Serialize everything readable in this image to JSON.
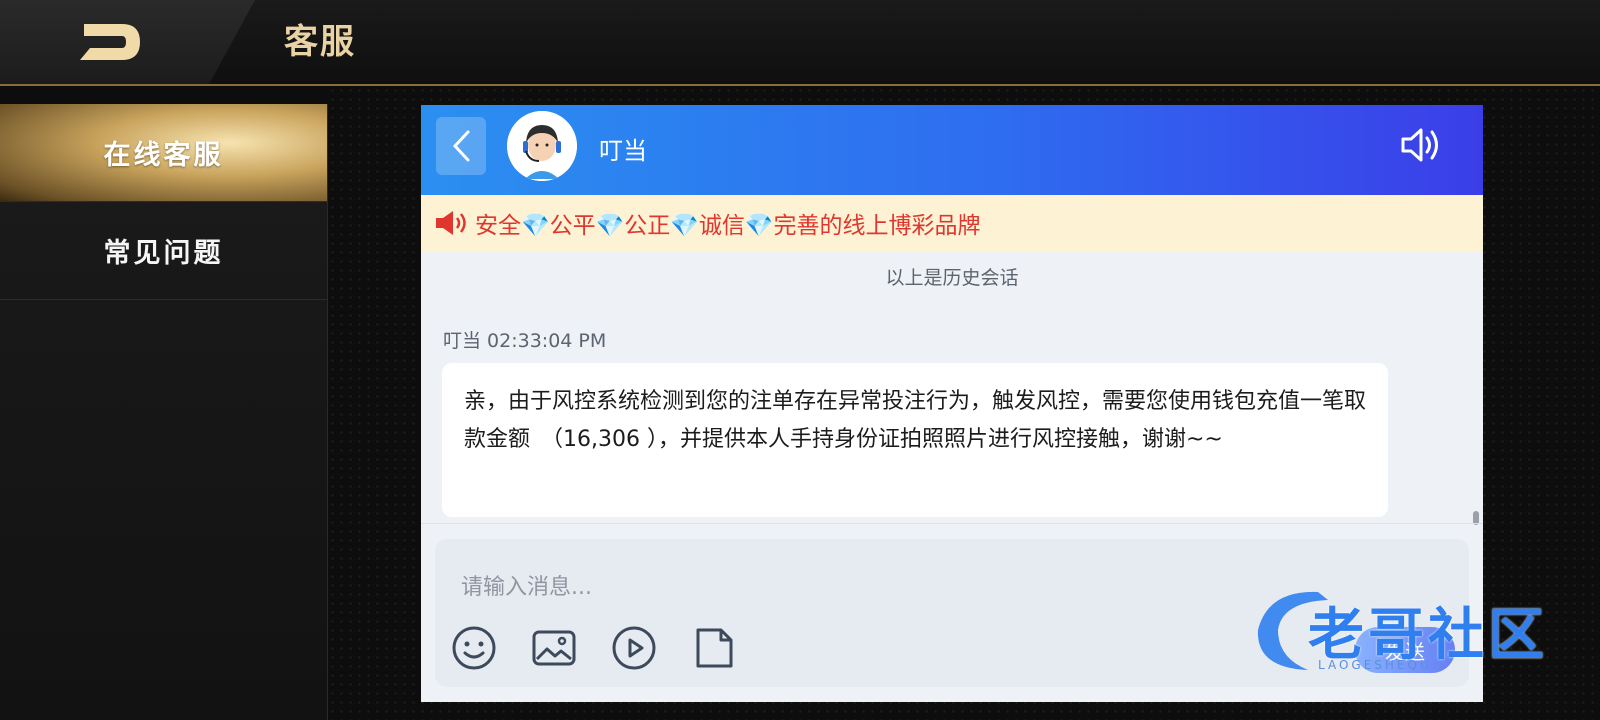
{
  "header": {
    "title": "客服",
    "back_icon": "brand-back-icon"
  },
  "sidebar": {
    "items": [
      {
        "label": "在线客服",
        "active": true
      },
      {
        "label": "常见问题",
        "active": false
      }
    ]
  },
  "chat": {
    "agent_name": "叮当",
    "notice_text": "安全💎公平💎公正💎诚信💎完善的线上博彩品牌",
    "history_tip": "以上是历史会话",
    "message": {
      "sender": "叮当",
      "time": "02:33:04 PM",
      "meta": "叮当 02:33:04 PM",
      "text": "亲，由于风控系统检测到您的注单存在异常投注行为，触发风控，需要您使用钱包充值一笔取款金额　（16,306 ），并提供本人手持身份证拍照照片进行风控接触，谢谢~~"
    },
    "input": {
      "placeholder": "请输入消息...",
      "send_label": "发送"
    },
    "tools": [
      "emoji-icon",
      "image-icon",
      "video-icon",
      "file-icon"
    ]
  },
  "watermark": {
    "text": "老哥社区",
    "sub": "LAOGESHEQU"
  },
  "colors": {
    "gold": "#e9d3a4",
    "header_blue": "#2e6cf0",
    "notice_red": "#e0362d",
    "notice_bg": "#fdf3d4"
  }
}
